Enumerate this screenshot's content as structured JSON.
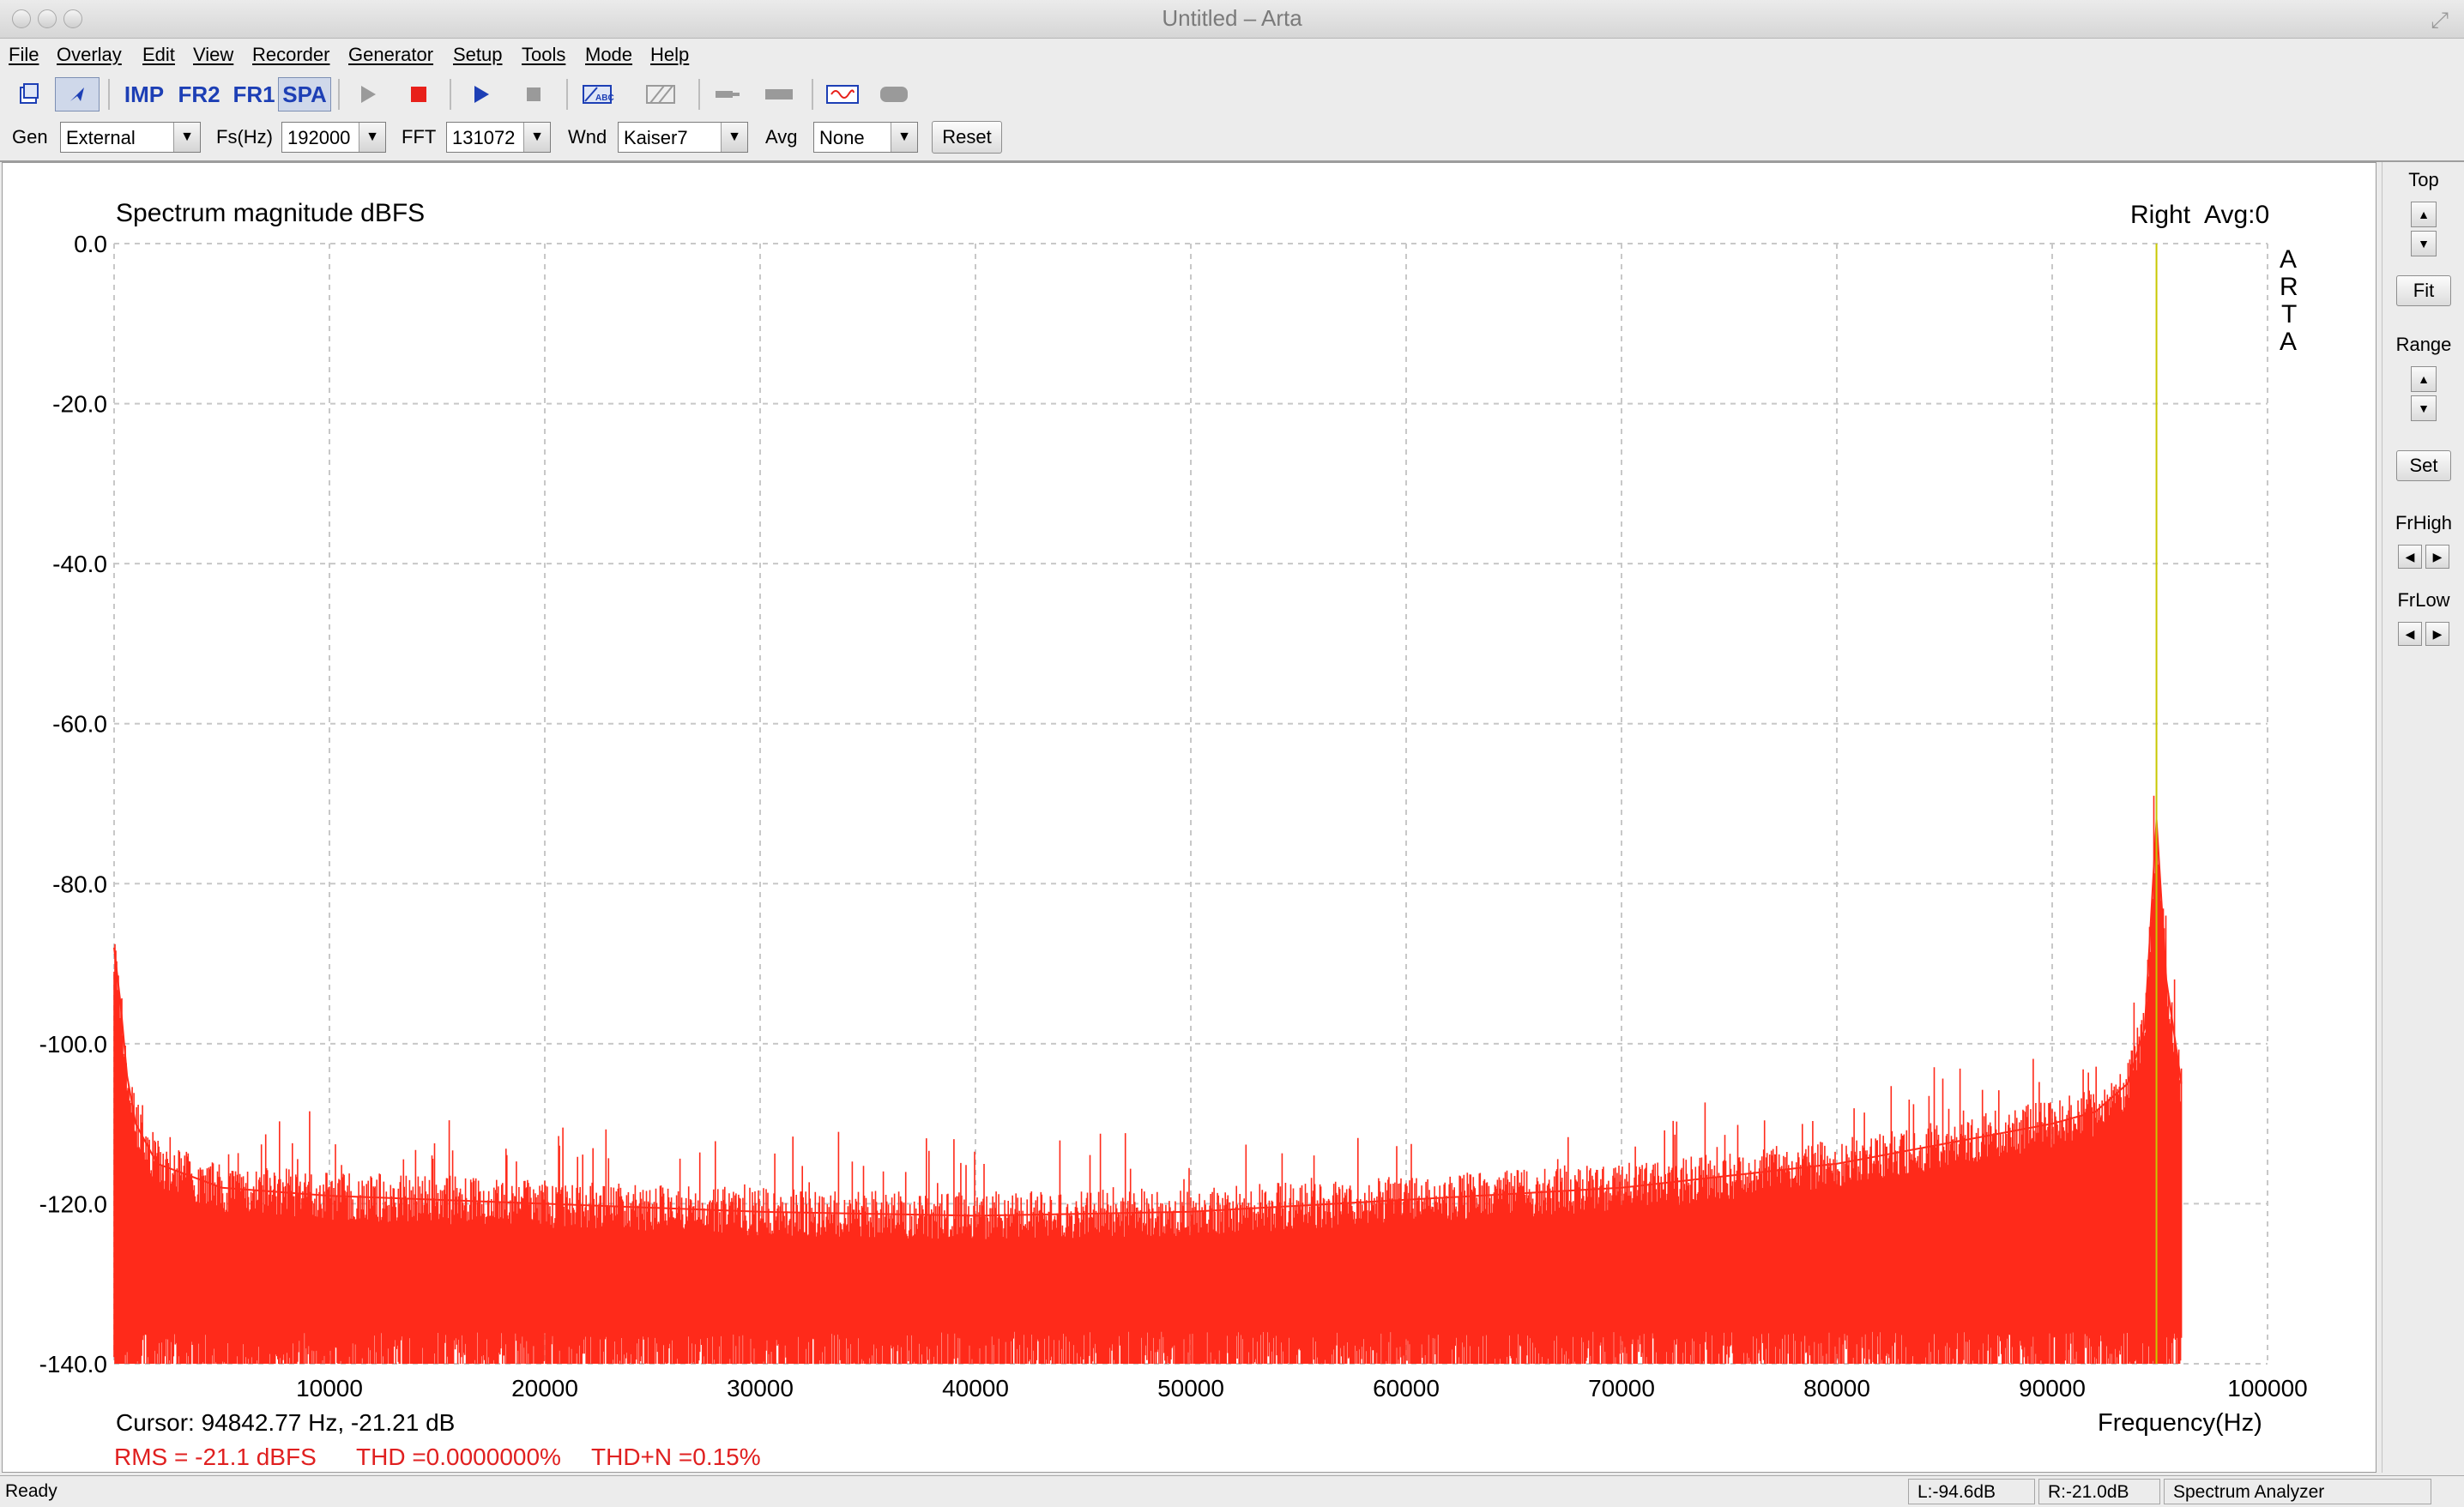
{
  "window": {
    "title": "Untitled – Arta"
  },
  "menu": [
    "File",
    "Overlay",
    "Edit",
    "View",
    "Recorder",
    "Generator",
    "Setup",
    "Tools",
    "Mode",
    "Help"
  ],
  "toolbar": {
    "imp": "IMP",
    "fr2": "FR2",
    "fr1": "FR1",
    "spa": "SPA"
  },
  "params": {
    "gen_label": "Gen",
    "gen_value": "External",
    "fs_label": "Fs(Hz)",
    "fs_value": "192000",
    "fft_label": "FFT",
    "fft_value": "131072",
    "wnd_label": "Wnd",
    "wnd_value": "Kaiser7",
    "avg_label": "Avg",
    "avg_value": "None",
    "reset_label": "Reset"
  },
  "side": {
    "top_label": "Top",
    "fit_label": "Fit",
    "range_label": "Range",
    "set_label": "Set",
    "frhigh_label": "FrHigh",
    "frlow_label": "FrLow"
  },
  "plot": {
    "title": "Spectrum magnitude dBFS",
    "channel": "Right",
    "avg": "Avg:0",
    "logo": [
      "A",
      "R",
      "T",
      "A"
    ],
    "cursor_text": "Cursor: 94842.77 Hz, -21.21 dB",
    "stats": {
      "rms": "RMS =  -21.1 dBFS",
      "thd": "THD =0.0000000%",
      "thdn": "THD+N =0.15%"
    }
  },
  "status": {
    "ready": "Ready",
    "left_level": "L:-94.6dB",
    "right_level": "R:-21.0dB",
    "mode": "Spectrum Analyzer"
  },
  "colors": {
    "trace": "#ff2a1a",
    "cursor": "#c8c800",
    "grid": "#c8c8c8",
    "stats": "#e02020"
  },
  "chart_data": {
    "type": "line",
    "title": "Spectrum magnitude dBFS",
    "xlabel": "Frequency(Hz)",
    "ylabel": "",
    "xlim": [
      0,
      100000
    ],
    "ylim": [
      -140,
      0
    ],
    "x_ticks": [
      10000,
      20000,
      30000,
      40000,
      50000,
      60000,
      70000,
      80000,
      90000,
      100000
    ],
    "x_tick_labels": [
      "10000",
      "20000",
      "30000",
      "40000",
      "50000",
      "60000",
      "70000",
      "80000",
      "90000",
      "100000"
    ],
    "y_ticks": [
      0,
      -20,
      -40,
      -60,
      -80,
      -100,
      -120,
      -140
    ],
    "y_tick_labels": [
      "0.0",
      "-20.0",
      "-40.0",
      "-60.0",
      "-80.0",
      "-100.0",
      "-120.0",
      "-140.0"
    ],
    "grid": true,
    "cursor_hz": 94842.77,
    "series": [
      {
        "x": [
          0,
          300,
          600,
          1000,
          2000,
          3000,
          5000,
          10000,
          20000,
          30000,
          40000,
          50000,
          60000,
          70000,
          75000,
          80000,
          85000,
          88000,
          90000,
          92000,
          93500,
          94300,
          94843,
          95300,
          96000
        ],
        "y": [
          -88,
          -95,
          -104,
          -110,
          -115,
          -116,
          -118,
          -119,
          -120,
          -121,
          -121.5,
          -121,
          -119.5,
          -118,
          -116.5,
          -115,
          -112.5,
          -111,
          -110,
          -108.5,
          -105,
          -98,
          -72,
          -92,
          -105
        ]
      }
    ]
  }
}
